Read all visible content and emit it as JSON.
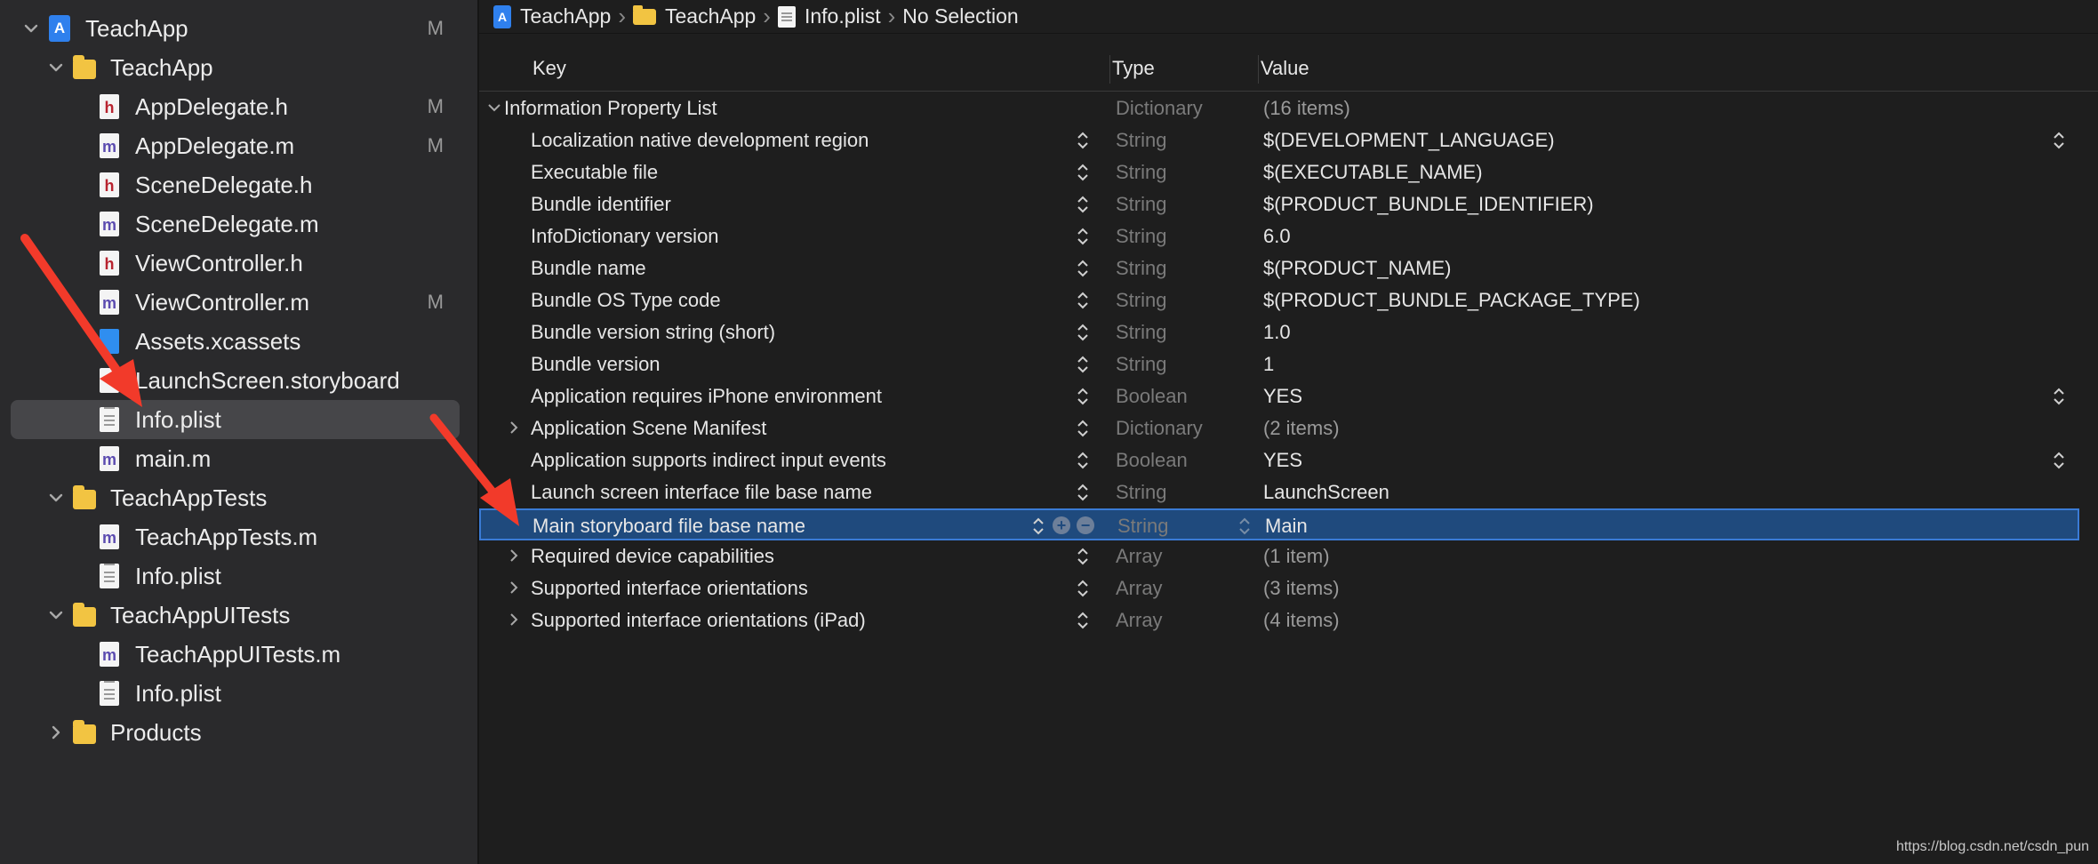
{
  "navigator": {
    "items": [
      {
        "label": "TeachApp",
        "icon": "project-icon",
        "disclosure": "expanded",
        "status": "M"
      },
      {
        "label": "TeachApp",
        "icon": "folder-icon",
        "disclosure": "expanded",
        "status": ""
      },
      {
        "label": "AppDelegate.h",
        "icon": "header-file-icon",
        "disclosure": "",
        "status": "M"
      },
      {
        "label": "AppDelegate.m",
        "icon": "objc-file-icon",
        "disclosure": "",
        "status": "M"
      },
      {
        "label": "SceneDelegate.h",
        "icon": "header-file-icon",
        "disclosure": "",
        "status": ""
      },
      {
        "label": "SceneDelegate.m",
        "icon": "objc-file-icon",
        "disclosure": "",
        "status": ""
      },
      {
        "label": "ViewController.h",
        "icon": "header-file-icon",
        "disclosure": "",
        "status": ""
      },
      {
        "label": "ViewController.m",
        "icon": "objc-file-icon",
        "disclosure": "",
        "status": "M"
      },
      {
        "label": "Assets.xcassets",
        "icon": "assets-icon",
        "disclosure": "",
        "status": ""
      },
      {
        "label": "LaunchScreen.storyboard",
        "icon": "storyboard-icon",
        "disclosure": "",
        "status": ""
      },
      {
        "label": "Info.plist",
        "icon": "plist-file-icon",
        "disclosure": "",
        "status": "",
        "selected": true
      },
      {
        "label": "main.m",
        "icon": "objc-file-icon",
        "disclosure": "",
        "status": ""
      },
      {
        "label": "TeachAppTests",
        "icon": "folder-icon",
        "disclosure": "expanded",
        "status": ""
      },
      {
        "label": "TeachAppTests.m",
        "icon": "objc-file-icon",
        "disclosure": "",
        "status": ""
      },
      {
        "label": "Info.plist",
        "icon": "plist-file-icon",
        "disclosure": "",
        "status": ""
      },
      {
        "label": "TeachAppUITests",
        "icon": "folder-icon",
        "disclosure": "expanded",
        "status": ""
      },
      {
        "label": "TeachAppUITests.m",
        "icon": "objc-file-icon",
        "disclosure": "",
        "status": ""
      },
      {
        "label": "Info.plist",
        "icon": "plist-file-icon",
        "disclosure": "",
        "status": ""
      },
      {
        "label": "Products",
        "icon": "folder-icon",
        "disclosure": "collapsed",
        "status": ""
      }
    ],
    "file_letters": {
      "h": "h",
      "m": "m",
      "project": "A"
    }
  },
  "jumpbar": {
    "crumbs": [
      "TeachApp",
      "TeachApp",
      "Info.plist",
      "No Selection"
    ]
  },
  "plist": {
    "headers": {
      "key": "Key",
      "type": "Type",
      "value": "Value"
    },
    "rows": [
      {
        "key": "Information Property List",
        "type": "Dictionary",
        "value": "(16 items)",
        "expander": "expanded",
        "root": true
      },
      {
        "key": "Localization native development region",
        "type": "String",
        "value": "$(DEVELOPMENT_LANGUAGE)",
        "value_stepper": true
      },
      {
        "key": "Executable file",
        "type": "String",
        "value": "$(EXECUTABLE_NAME)"
      },
      {
        "key": "Bundle identifier",
        "type": "String",
        "value": "$(PRODUCT_BUNDLE_IDENTIFIER)"
      },
      {
        "key": "InfoDictionary version",
        "type": "String",
        "value": "6.0"
      },
      {
        "key": "Bundle name",
        "type": "String",
        "value": "$(PRODUCT_NAME)"
      },
      {
        "key": "Bundle OS Type code",
        "type": "String",
        "value": "$(PRODUCT_BUNDLE_PACKAGE_TYPE)"
      },
      {
        "key": "Bundle version string (short)",
        "type": "String",
        "value": "1.0"
      },
      {
        "key": "Bundle version",
        "type": "String",
        "value": "1"
      },
      {
        "key": "Application requires iPhone environment",
        "type": "Boolean",
        "value": "YES",
        "value_stepper": true
      },
      {
        "key": "Application Scene Manifest",
        "type": "Dictionary",
        "value": "(2 items)",
        "expander": "collapsed"
      },
      {
        "key": "Application supports indirect input events",
        "type": "Boolean",
        "value": "YES",
        "value_stepper": true
      },
      {
        "key": "Launch screen interface file base name",
        "type": "String",
        "value": "LaunchScreen"
      },
      {
        "key": "Main storyboard file base name",
        "type": "String",
        "value": "Main",
        "selected": true
      },
      {
        "key": "Required device capabilities",
        "type": "Array",
        "value": "(1 item)",
        "expander": "collapsed"
      },
      {
        "key": "Supported interface orientations",
        "type": "Array",
        "value": "(3 items)",
        "expander": "collapsed"
      },
      {
        "key": "Supported interface orientations (iPad)",
        "type": "Array",
        "value": "(4 items)",
        "expander": "collapsed"
      }
    ],
    "buttons": {
      "add": "+",
      "remove": "−"
    }
  },
  "watermark": "https://blog.csdn.net/csdn_pun",
  "colors": {
    "selection": "#1f4a7d",
    "selection_border": "#3a7bd5",
    "annotation_arrow": "#f23a2a",
    "folder": "#f2c442"
  }
}
